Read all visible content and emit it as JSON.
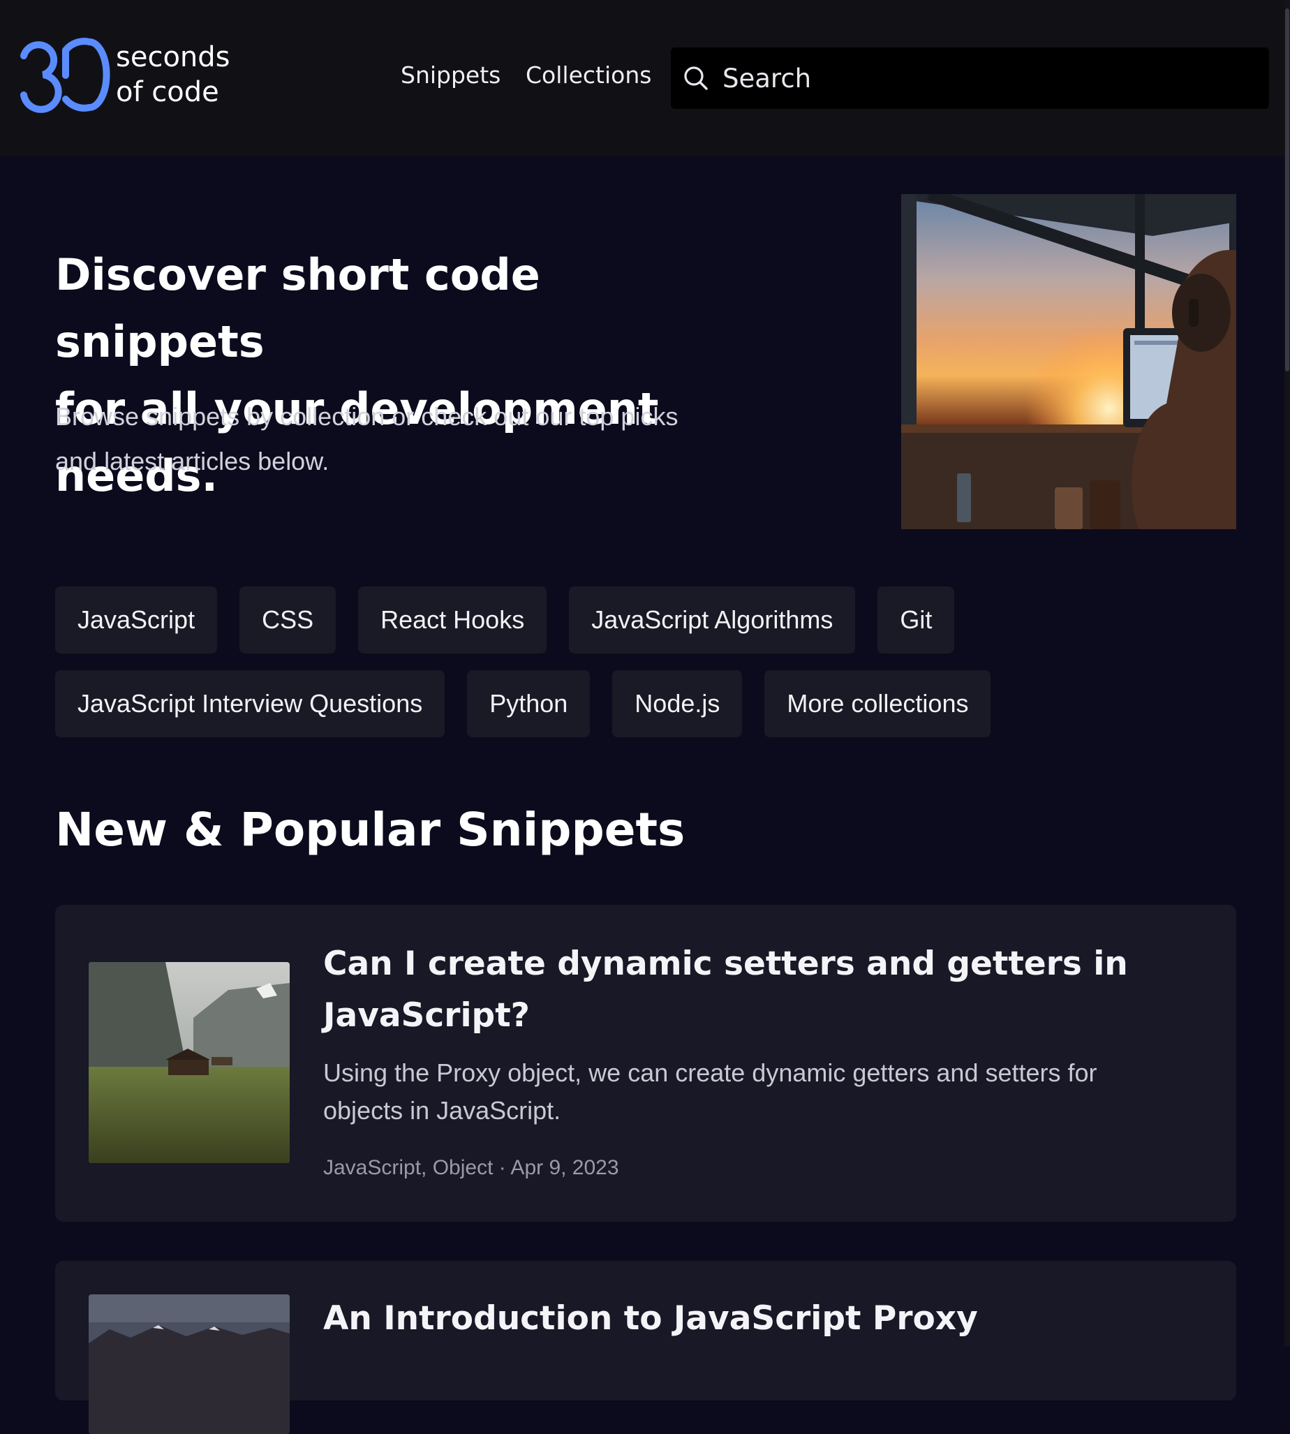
{
  "header": {
    "logo_line1": "seconds",
    "logo_line2": "of code",
    "nav": {
      "snippets": "Snippets",
      "collections": "Collections"
    },
    "search_placeholder": "Search"
  },
  "hero": {
    "title_line1": "Discover short code snippets",
    "title_line2": "for all your development needs.",
    "subtitle_line1": "Browse snippets by collection or check out our top picks",
    "subtitle_line2": "and latest articles below."
  },
  "collections": {
    "row1": [
      "JavaScript",
      "CSS",
      "React Hooks",
      "JavaScript Algorithms",
      "Git"
    ],
    "row2": [
      "JavaScript Interview Questions",
      "Python",
      "Node.js",
      "More collections"
    ]
  },
  "section_title": "New & Popular Snippets",
  "snippets": [
    {
      "title_line1": "Can I create dynamic setters and getters in",
      "title_line2": "JavaScript?",
      "description_line1": "Using the Proxy object, we can create dynamic getters and setters for",
      "description_line2": "objects in JavaScript.",
      "meta": "JavaScript, Object · Apr 9, 2023"
    },
    {
      "title_line1": "An Introduction to JavaScript Proxy"
    }
  ],
  "colors": {
    "brand_blue": "#5b8cff",
    "background": "#0b0b1d",
    "header_bg": "#111115",
    "chip_bg": "#1a1a26",
    "card_bg": "#181826"
  }
}
